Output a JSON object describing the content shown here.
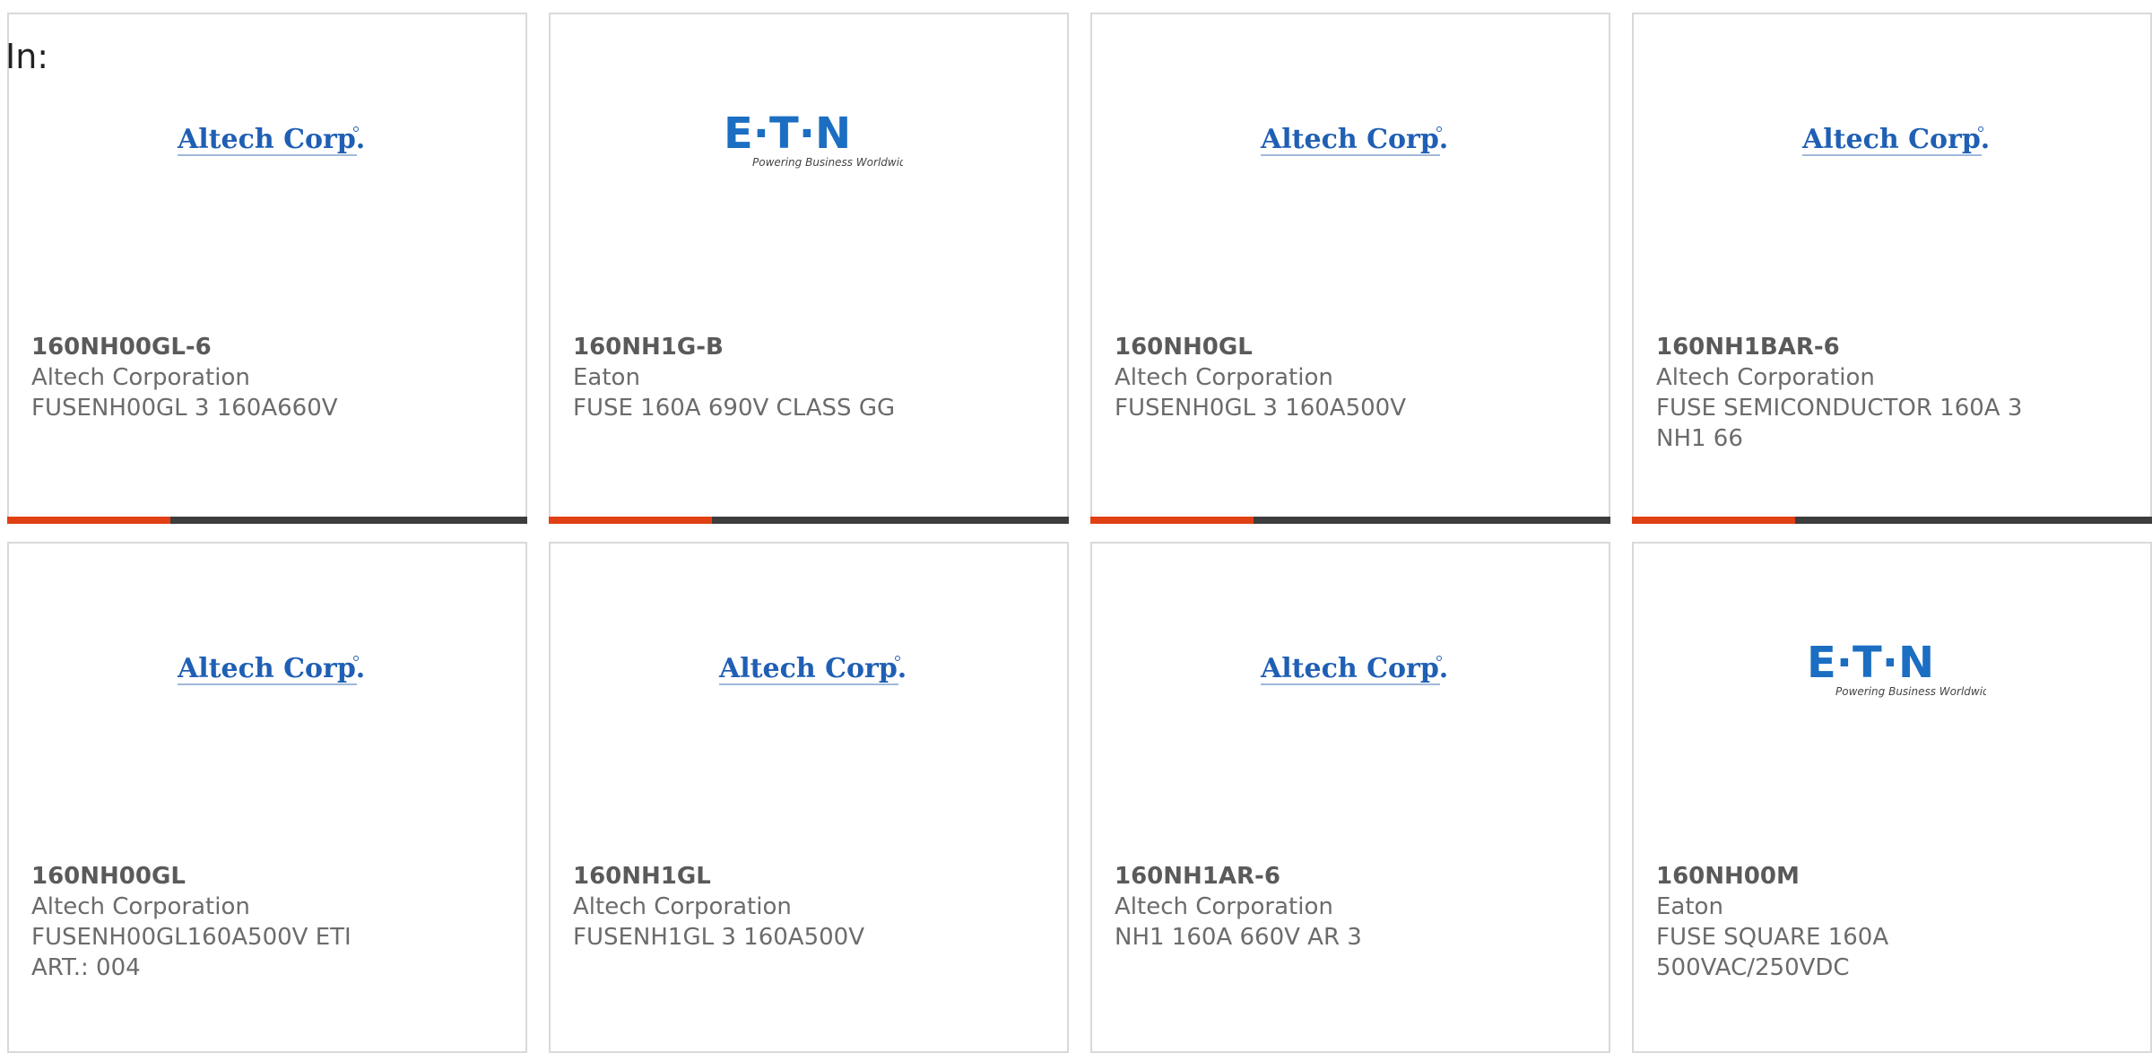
{
  "filter_label": "In:",
  "colors": {
    "accent": "#e14014",
    "bar": "#3d3d3d",
    "altech_blue": "#1f5fb4",
    "eaton_blue": "#1b6ec2"
  },
  "logos": {
    "altech": "Altech Corp.",
    "eaton_main": "E·T·N",
    "eaton_tagline": "Powering Business Worldwide"
  },
  "products": [
    {
      "part": "160NH00GL-6",
      "brand": "Altech Corporation",
      "logo": "altech",
      "desc": "FUSENH00GL 3 160A660V"
    },
    {
      "part": "160NH1G-B",
      "brand": "Eaton",
      "logo": "eaton",
      "desc": "FUSE 160A 690V CLASS GG"
    },
    {
      "part": "160NH0GL",
      "brand": "Altech Corporation",
      "logo": "altech",
      "desc": "FUSENH0GL 3 160A500V"
    },
    {
      "part": "160NH1BAR-6",
      "brand": "Altech Corporation",
      "logo": "altech",
      "desc": "FUSE SEMICONDUCTOR 160A 3 NH1 66"
    },
    {
      "part": "160NH00GL",
      "brand": "Altech Corporation",
      "logo": "altech",
      "desc": "FUSENH00GL160A500V ETI ART.: 004"
    },
    {
      "part": "160NH1GL",
      "brand": "Altech Corporation",
      "logo": "altech",
      "desc": "FUSENH1GL 3 160A500V"
    },
    {
      "part": "160NH1AR-6",
      "brand": "Altech Corporation",
      "logo": "altech",
      "desc": "NH1 160A 660V AR 3"
    },
    {
      "part": "160NH00M",
      "brand": "Eaton",
      "logo": "eaton",
      "desc": "FUSE SQUARE 160A 500VAC/250VDC"
    }
  ]
}
